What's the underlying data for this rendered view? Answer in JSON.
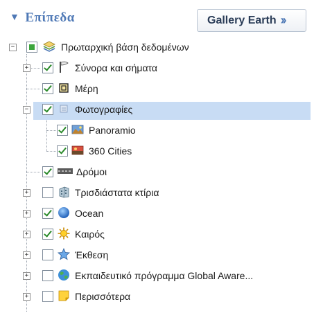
{
  "header": {
    "title": "Επίπεδα",
    "gallery_button": "Gallery Earth"
  },
  "tree": {
    "root": {
      "label": "Πρωταρχική βάση δεδομένων"
    },
    "items": [
      {
        "label": "Σύνορα και σήματα",
        "checked": true,
        "expander": "+"
      },
      {
        "label": "Μέρη",
        "checked": true,
        "expander": ""
      },
      {
        "label": "Φωτογραφίες",
        "checked": true,
        "expander": "−"
      },
      {
        "label": "Panoramio",
        "checked": true,
        "expander": ""
      },
      {
        "label": "360 Cities",
        "checked": true,
        "expander": ""
      },
      {
        "label": "Δρόμοι",
        "checked": true,
        "expander": ""
      },
      {
        "label": "Τρισδιάστατα κτίρια",
        "checked": false,
        "expander": "+"
      },
      {
        "label": "Ocean",
        "checked": true,
        "expander": "+"
      },
      {
        "label": "Καιρός",
        "checked": true,
        "expander": "+"
      },
      {
        "label": "Έκθεση",
        "checked": false,
        "expander": "+"
      },
      {
        "label": "Εκπαιδευτικό πρόγραμμα Global Aware...",
        "checked": false,
        "expander": "+"
      },
      {
        "label": "Περισσότερα",
        "checked": false,
        "expander": "+"
      }
    ]
  },
  "colors": {
    "accent": "#4f79b6",
    "selection": "#c8dcf4"
  }
}
